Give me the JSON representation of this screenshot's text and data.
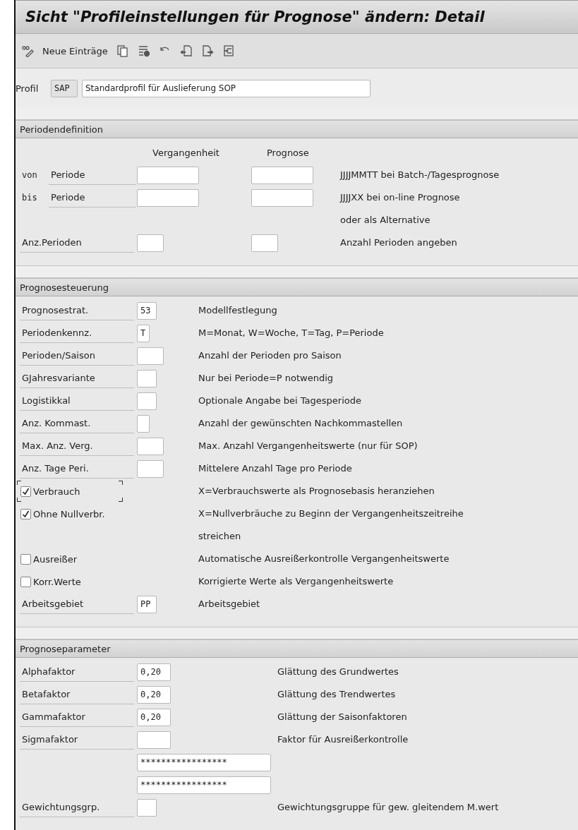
{
  "window": {
    "title": "Sicht \"Profileinstellungen für Prognose\" ändern: Detail"
  },
  "toolbar": {
    "new_entries": "Neue Einträge"
  },
  "profile": {
    "label": "Profil",
    "code": "SAP",
    "description": "Standardprofil für Auslieferung SOP"
  },
  "period_definition": {
    "title": "Periodendefinition",
    "columns": [
      "Vergangenheit",
      "Prognose"
    ],
    "rows": [
      {
        "kind": "range",
        "prefix": "von",
        "label": "Periode",
        "note": "JJJJMMTT bei Batch-/Tagesprognose"
      },
      {
        "kind": "range",
        "prefix": "bis",
        "label": "Periode",
        "note": "JJJJXX bei on-line Prognose"
      },
      {
        "kind": "note",
        "note": "oder als Alternative"
      },
      {
        "kind": "count",
        "label": "Anz.Perioden",
        "note": "Anzahl Perioden angeben"
      }
    ]
  },
  "forecast_control": {
    "title": "Prognosesteuerung",
    "rows": [
      {
        "kind": "field",
        "label": "Prognosestrat.",
        "value": "53",
        "description": "Modellfestlegung"
      },
      {
        "kind": "field",
        "label": "Periodenkennz.",
        "value": "T",
        "description": "M=Monat, W=Woche, T=Tag, P=Periode"
      },
      {
        "kind": "field",
        "label": "Perioden/Saison",
        "description": "Anzahl der Perioden pro Saison"
      },
      {
        "kind": "field",
        "label": "GJahresvariante",
        "description": "Nur bei Periode=P notwendig"
      },
      {
        "kind": "field",
        "label": "Logistikkal",
        "description": "Optionale Angabe bei Tagesperiode"
      },
      {
        "kind": "field",
        "label": "Anz. Kommast.",
        "description": "Anzahl der gewünschten Nachkommastellen"
      },
      {
        "kind": "field",
        "label": "Max. Anz. Verg.",
        "description": "Max. Anzahl Vergangenheitswerte (nur für SOP)"
      },
      {
        "kind": "field",
        "label": "Anz. Tage Peri.",
        "description": "Mittelere Anzahl Tage pro Periode"
      },
      {
        "kind": "checkbox",
        "label": "Verbrauch",
        "checked": true,
        "focused": true,
        "description": "X=Verbrauchswerte als Prognosebasis heranziehen"
      },
      {
        "kind": "checkbox",
        "label": "Ohne Nullverbr.",
        "checked": true,
        "focused": false,
        "description": "X=Nullverbräuche zu Beginn der Vergangenheitszeitreihe streichen"
      },
      {
        "kind": "checkbox",
        "label": "Ausreißer",
        "checked": false,
        "focused": false,
        "description": "Automatische Ausreißerkontrolle Vergangenheitswerte"
      },
      {
        "kind": "checkbox",
        "label": "Korr.Werte",
        "checked": false,
        "focused": false,
        "description": "Korrigierte Werte als Vergangenheitswerte"
      },
      {
        "kind": "field",
        "label": "Arbeitsgebiet",
        "value": "PP",
        "description": "Arbeitsgebiet"
      }
    ]
  },
  "forecast_parameters": {
    "title": "Prognoseparameter",
    "rows": [
      {
        "kind": "field",
        "label": "Alphafaktor",
        "value": "0,20",
        "description": "Glättung des Grundwertes"
      },
      {
        "kind": "field",
        "label": "Betafaktor",
        "value": "0,20",
        "description": "Glättung des Trendwertes"
      },
      {
        "kind": "field",
        "label": "Gammafaktor",
        "value": "0,20",
        "description": "Glättung der Saisonfaktoren"
      },
      {
        "kind": "field",
        "label": "Sigmafaktor",
        "description": "Faktor für Ausreißerkontrolle"
      },
      {
        "kind": "masked",
        "value": "*****************"
      },
      {
        "kind": "masked",
        "value": "*****************"
      },
      {
        "kind": "field",
        "label": "Gewichtungsgrp.",
        "description": "Gewichtungsgruppe für gew. gleitendem M.wert"
      }
    ]
  }
}
